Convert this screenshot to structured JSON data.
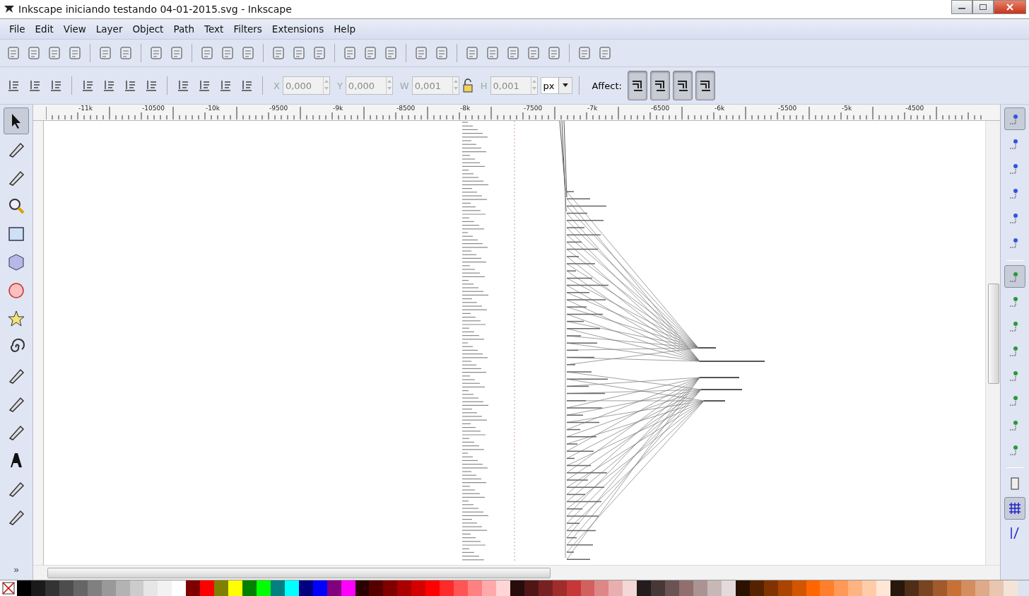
{
  "window": {
    "title": "Inkscape iniciando testando 04-01-2015.svg - Inkscape"
  },
  "menu": [
    {
      "label": "File"
    },
    {
      "label": "Edit"
    },
    {
      "label": "View"
    },
    {
      "label": "Layer"
    },
    {
      "label": "Object"
    },
    {
      "label": "Path"
    },
    {
      "label": "Text"
    },
    {
      "label": "Filters"
    },
    {
      "label": "Extensions"
    },
    {
      "label": "Help"
    }
  ],
  "tool_controls": {
    "fields": [
      {
        "label": "X",
        "value": "0,000"
      },
      {
        "label": "Y",
        "value": "0,000"
      },
      {
        "label": "W",
        "value": "0,001"
      },
      {
        "label": "H",
        "value": "0,001"
      }
    ],
    "unit": "px",
    "affect_label": "Affect:",
    "affect_buttons": [
      {
        "on": true
      },
      {
        "on": true
      },
      {
        "on": true
      },
      {
        "on": true
      }
    ]
  },
  "ruler": {
    "labels": [
      "-11k",
      "-10500",
      "-10k",
      "-9500",
      "-9k",
      "-8500",
      "-8k",
      "-7500",
      "-7k",
      "-6500",
      "-6k",
      "-5500",
      "-5k",
      "-4500"
    ]
  },
  "tools": [
    {
      "selected": true
    },
    {
      "selected": false
    },
    {
      "selected": false
    },
    {
      "selected": false
    },
    {
      "selected": false
    },
    {
      "selected": false
    },
    {
      "selected": false
    },
    {
      "selected": false
    },
    {
      "selected": false
    },
    {
      "selected": false
    },
    {
      "selected": false
    },
    {
      "selected": false
    },
    {
      "selected": false
    },
    {
      "selected": false
    },
    {
      "selected": false
    }
  ],
  "toolbox_more": "»",
  "snap_controls": [
    {
      "on": true
    },
    {
      "on": false
    },
    {
      "on": false
    },
    {
      "on": false
    },
    {
      "on": false
    },
    {
      "on": false
    },
    {
      "on": true
    },
    {
      "on": false
    },
    {
      "on": false
    },
    {
      "on": false
    },
    {
      "on": false
    },
    {
      "on": false
    },
    {
      "on": false
    },
    {
      "on": false
    },
    {
      "on": false
    },
    {
      "on": true
    },
    {
      "on": false
    }
  ],
  "palette": [
    {
      "color": "#000000"
    },
    {
      "color": "#1a1a1a"
    },
    {
      "color": "#333333"
    },
    {
      "color": "#4d4d4d"
    },
    {
      "color": "#666666"
    },
    {
      "color": "#808080"
    },
    {
      "color": "#999999"
    },
    {
      "color": "#b3b3b3"
    },
    {
      "color": "#cccccc"
    },
    {
      "color": "#e6e6e6"
    },
    {
      "color": "#f2f2f2"
    },
    {
      "color": "#ffffff"
    },
    {
      "color": "#800000"
    },
    {
      "color": "#ff0000"
    },
    {
      "color": "#808000"
    },
    {
      "color": "#ffff00"
    },
    {
      "color": "#008000"
    },
    {
      "color": "#00ff00"
    },
    {
      "color": "#008080"
    },
    {
      "color": "#00ffff"
    },
    {
      "color": "#000080"
    },
    {
      "color": "#0000ff"
    },
    {
      "color": "#800080"
    },
    {
      "color": "#ff00ff"
    },
    {
      "color": "#2b0000"
    },
    {
      "color": "#550000"
    },
    {
      "color": "#800000"
    },
    {
      "color": "#aa0000"
    },
    {
      "color": "#d40000"
    },
    {
      "color": "#ff0000"
    },
    {
      "color": "#ff2a2a"
    },
    {
      "color": "#ff5555"
    },
    {
      "color": "#ff8080"
    },
    {
      "color": "#ffaaaa"
    },
    {
      "color": "#ffd5d5"
    },
    {
      "color": "#280b0b"
    },
    {
      "color": "#501616"
    },
    {
      "color": "#782121"
    },
    {
      "color": "#a02c2c"
    },
    {
      "color": "#c83737"
    },
    {
      "color": "#d35f5f"
    },
    {
      "color": "#de8787"
    },
    {
      "color": "#e9afaf"
    },
    {
      "color": "#f4d7d7"
    },
    {
      "color": "#241c1c"
    },
    {
      "color": "#483737"
    },
    {
      "color": "#6c5353"
    },
    {
      "color": "#916f6f"
    },
    {
      "color": "#ac9393"
    },
    {
      "color": "#c8b7b7"
    },
    {
      "color": "#e3dbdb"
    },
    {
      "color": "#2b1100"
    },
    {
      "color": "#552200"
    },
    {
      "color": "#803300"
    },
    {
      "color": "#aa4400"
    },
    {
      "color": "#d45500"
    },
    {
      "color": "#ff6600"
    },
    {
      "color": "#ff7f2a"
    },
    {
      "color": "#ff9955"
    },
    {
      "color": "#ffb380"
    },
    {
      "color": "#ffccaa"
    },
    {
      "color": "#ffe6d5"
    },
    {
      "color": "#28170b"
    },
    {
      "color": "#502d16"
    },
    {
      "color": "#784421"
    },
    {
      "color": "#a05a2c"
    },
    {
      "color": "#c87137"
    },
    {
      "color": "#d38d5f"
    },
    {
      "color": "#deaa87"
    },
    {
      "color": "#e9c6af"
    },
    {
      "color": "#f4e3d7"
    }
  ]
}
